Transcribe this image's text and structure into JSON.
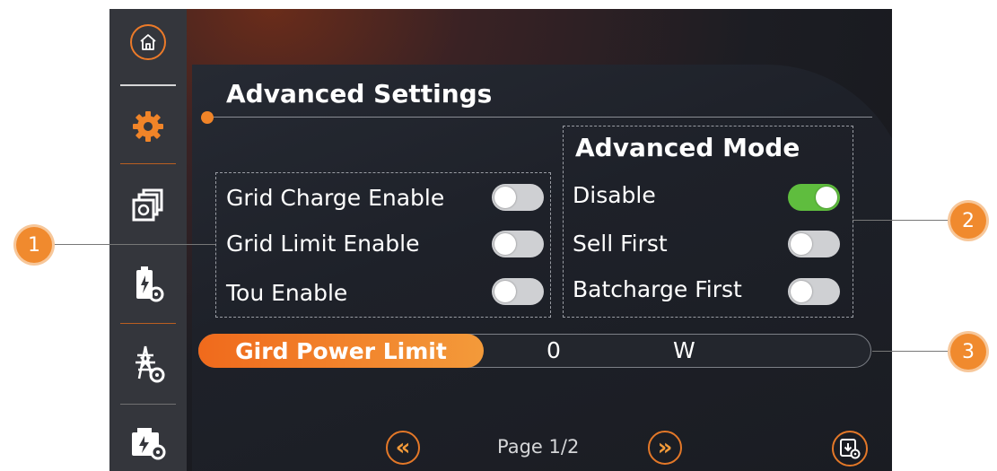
{
  "header": {
    "title": "Advanced Settings"
  },
  "grid_settings": {
    "items": [
      {
        "label": "Grid Charge Enable",
        "state": "off"
      },
      {
        "label": "Grid Limit Enable",
        "state": "off"
      },
      {
        "label": "Tou Enable",
        "state": "off"
      }
    ]
  },
  "advanced_mode": {
    "title": "Advanced Mode",
    "items": [
      {
        "label": "Disable",
        "state": "on"
      },
      {
        "label": "Sell First",
        "state": "off"
      },
      {
        "label": "Batcharge First",
        "state": "off"
      }
    ]
  },
  "power_limit": {
    "label": "Gird Power Limit",
    "value": "0",
    "unit": "W"
  },
  "pagination": {
    "page": "Page 1/2",
    "prev_symbol": "«",
    "next_symbol": "»"
  },
  "callouts": [
    "1",
    "2",
    "3"
  ],
  "sidebar": {
    "items": [
      "home-icon",
      "gear-icon",
      "multi-settings-icon",
      "battery-settings-icon",
      "grid-tower-settings-icon",
      "generator-settings-icon"
    ]
  },
  "colors": {
    "accent": "#f08428",
    "toggle_on": "#5fbd3e",
    "toggle_off": "#cfd0d3",
    "sidebar": "#34363c"
  }
}
